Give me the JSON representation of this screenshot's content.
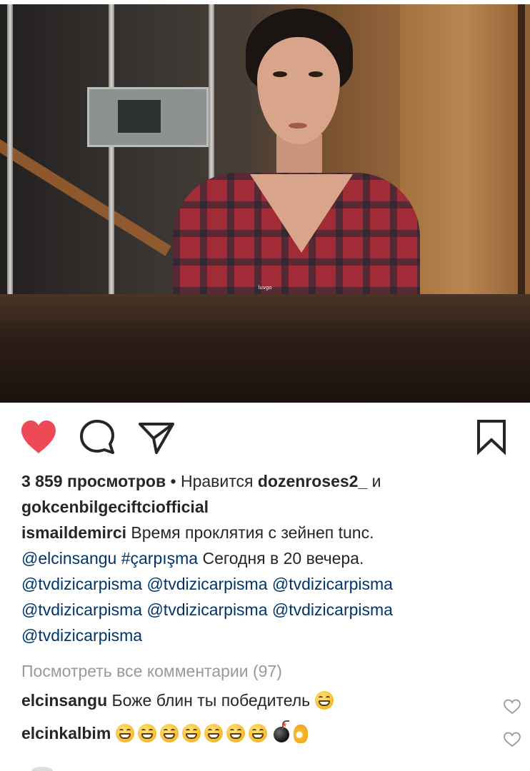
{
  "video": {
    "subtitle_text": "luvgo"
  },
  "actions": {
    "like_icon": "heart-filled-icon",
    "like_color": "#ed4956",
    "comment_icon": "comment-bubble-icon",
    "share_icon": "paper-plane-icon",
    "save_icon": "bookmark-icon"
  },
  "stats": {
    "views": "3 859 просмотров",
    "separator": "•",
    "liked_by_prefix": "Нравится",
    "liked_user_1": "dozenroses2_",
    "and_word": "и",
    "liked_user_2": "gokcenbilgeciftciofficial"
  },
  "caption": {
    "author": "ismaildemirci",
    "text_1": "Время проклятия с зейнеп tunc.",
    "mention_1": "@elcinsangu",
    "hashtag": "#çarpışma",
    "text_2": "Сегодня в 20 вечера.",
    "tags": [
      "@tvdizicarpisma",
      "@tvdizicarpisma",
      "@tvdizicarpisma",
      "@tvdizicarpisma",
      "@tvdizicarpisma",
      "@tvdizicarpisma",
      "@tvdizicarpisma"
    ]
  },
  "view_all_comments": "Посмотреть все комментарии (97)",
  "comments": [
    {
      "user": "elcinsangu",
      "text": "Боже блин ты победитель",
      "emoji": [
        "grinning-face"
      ]
    },
    {
      "user": "elcinkalbim",
      "text": "",
      "emoji": [
        "grinning-face",
        "grinning-face",
        "grinning-face",
        "grinning-face",
        "grinning-face",
        "grinning-face",
        "grinning-face",
        "bomb",
        "ok-hand"
      ]
    }
  ],
  "colors": {
    "link": "#003569",
    "muted": "#999999",
    "text": "#262626"
  }
}
